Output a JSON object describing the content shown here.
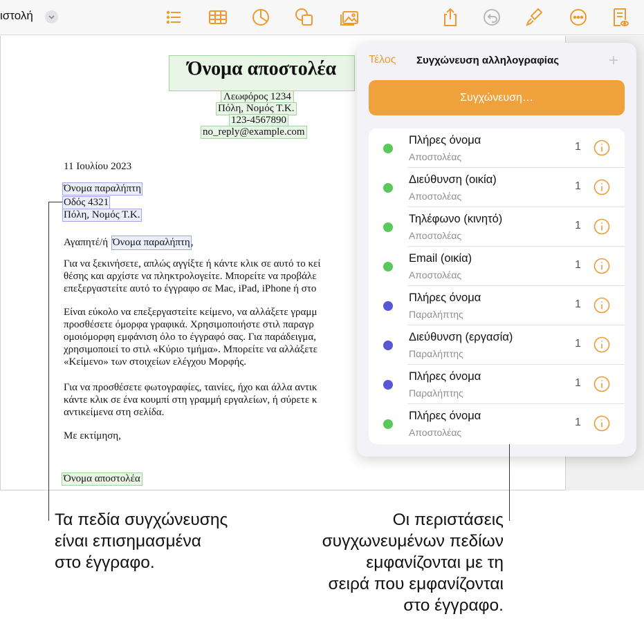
{
  "toolbar": {
    "doc_title": "ιστολή",
    "icons": [
      "chevron-down-icon",
      "list-icon",
      "table-icon",
      "chart-icon",
      "shape-icon",
      "media-icon",
      "share-icon",
      "undo-icon",
      "paintbrush-icon",
      "more-icon",
      "reader-icon"
    ]
  },
  "document": {
    "sender_name": "Όνομα αποστολέα",
    "address_line": "Λεωφόρος 1234",
    "city_line": "Πόλη, Νομός Τ.Κ.",
    "phone": "123-4567890",
    "email": "no_reply@example.com",
    "date": "11 Ιουλίου 2023",
    "recipient_name": "Όνομα παραλήπτη",
    "recipient_street": "Οδός 4321",
    "recipient_city": "Πόλη, Νομός Τ.Κ.",
    "salutation_prefix": "Αγαπητέ/ή",
    "salutation_field": "Όνομα παραλήπτη",
    "salutation_suffix": ",",
    "para1": [
      "Για να ξεκινήσετε, απλώς αγγίξτε ή κάντε κλικ σε αυτό το κεί",
      "θέσης και αρχίστε να πληκτρολογείτε. Μπορείτε να προβάλε",
      "επεξεργαστείτε αυτό το έγγραφο σε Mac, iPad, iPhone ή στο"
    ],
    "para2": [
      "Είναι εύκολο να επεξεργαστείτε κείμενο, να αλλάξετε γραμμ",
      "προσθέσετε όμορφα γραφικά. Χρησιμοποιήστε στιλ παραγρ",
      "ομοιόμορφη εμφάνιση όλο το έγγραφό σας. Για παράδειγμα,",
      "χρησιμοποιεί το στιλ «Κύριο τμήμα». Μπορείτε να αλλάξετε",
      "«Κείμενο» των στοιχείων ελέγχου Μορφής."
    ],
    "para3": [
      "Για να προσθέσετε φωτογραφίες, ταινίες, ήχο και άλλα αντικ",
      "κάντε κλικ σε ένα κουμπί στη γραμμή εργαλείων, ή σύρετε κ",
      "αντικείμενα στη σελίδα."
    ],
    "closing": "Με εκτίμηση,",
    "signature": "Όνομα αποστολέα"
  },
  "panel": {
    "done_label": "Τέλος",
    "title": "Συγχώνευση αλληλογραφίας",
    "add_label": "+",
    "merge_button": "Συγχώνευση…",
    "colors": {
      "sender": "#5ac85a",
      "recipient": "#5a57d6",
      "accent": "#ee9a33"
    },
    "fields": [
      {
        "name": "Πλήρες όνομα",
        "source": "Αποστολέας",
        "count": "1",
        "kind": "sender"
      },
      {
        "name": "Διεύθυνση (οικία)",
        "source": "Αποστολέας",
        "count": "1",
        "kind": "sender"
      },
      {
        "name": "Τηλέφωνο (κινητό)",
        "source": "Αποστολέας",
        "count": "1",
        "kind": "sender"
      },
      {
        "name": "Email (οικία)",
        "source": "Αποστολέας",
        "count": "1",
        "kind": "sender"
      },
      {
        "name": "Πλήρες όνομα",
        "source": "Παραλήπτης",
        "count": "1",
        "kind": "recipient"
      },
      {
        "name": "Διεύθυνση (εργασία)",
        "source": "Παραλήπτης",
        "count": "1",
        "kind": "recipient"
      },
      {
        "name": "Πλήρες όνομα",
        "source": "Παραλήπτης",
        "count": "1",
        "kind": "recipient"
      },
      {
        "name": "Πλήρες όνομα",
        "source": "Αποστολέας",
        "count": "1",
        "kind": "sender"
      }
    ]
  },
  "callouts": {
    "left": [
      "Τα πεδία συγχώνευσης",
      "είναι επισημασμένα",
      "στο έγγραφο."
    ],
    "right": [
      "Οι περιστάσεις",
      "συγχωνευμένων πεδίων",
      "εμφανίζονται με τη",
      "σειρά που εμφανίζονται",
      "στο έγγραφο."
    ]
  }
}
